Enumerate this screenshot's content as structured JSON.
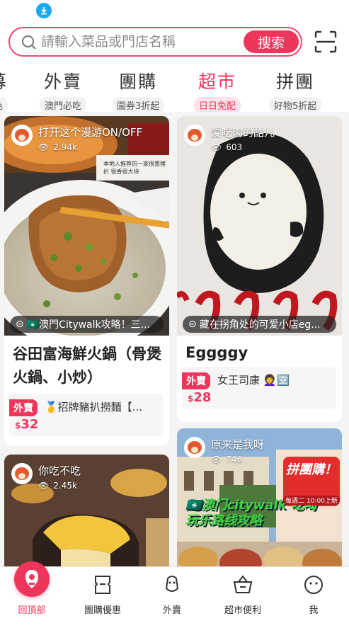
{
  "search": {
    "placeholder": "請輸入菜品或門店名稱",
    "button_label": "搜索"
  },
  "categories": [
    {
      "label": "募",
      "sub": "色"
    },
    {
      "label": "外賣",
      "sub": "澳門必吃"
    },
    {
      "label": "團購",
      "sub": "圍券3折起"
    },
    {
      "label": "超市",
      "sub": "日日免配",
      "active": true
    },
    {
      "label": "拼團",
      "sub": "好物5折起"
    }
  ],
  "cards": [
    {
      "author": "打开这个漫游ON/OFF",
      "views": "2.94k",
      "tag": "🇲🇴澳門Citywalk攻略！三...",
      "title": "谷田富海鮮火鍋（骨煲火鍋、小炒）",
      "badge": "外賣",
      "shop": "🥇招牌豬扒撈麵【...",
      "price_symbol": "$",
      "price": "32"
    },
    {
      "author": "爱吃肉的酷儿",
      "views": "603",
      "tag": "藏在拐角处的可爱小店eg...",
      "title": "Eggggy",
      "badge": "外賣",
      "shop": "女王司康 👩‍🦱🈳",
      "price_symbol": "$",
      "price": "28"
    },
    {
      "author": "你吃不吃",
      "views": "2.45k"
    },
    {
      "author": "原来是我呀",
      "views": "746",
      "overlay_text": "🇲🇴澳门citywalk 吃喝玩乐路线攻略",
      "promo_text": "拼團購！",
      "promo_sub": "每週二 10:00上新"
    }
  ],
  "image_text": {
    "small_note": "本地人推荐的一家很惠猪扒 很香很大块"
  },
  "nav": [
    {
      "label": "回頂部",
      "active": true
    },
    {
      "label": "團購優惠"
    },
    {
      "label": "外賣"
    },
    {
      "label": "超市便利"
    },
    {
      "label": "我"
    }
  ],
  "colors": {
    "accent": "#f0355d",
    "status_icon": "#1aa7ec"
  }
}
